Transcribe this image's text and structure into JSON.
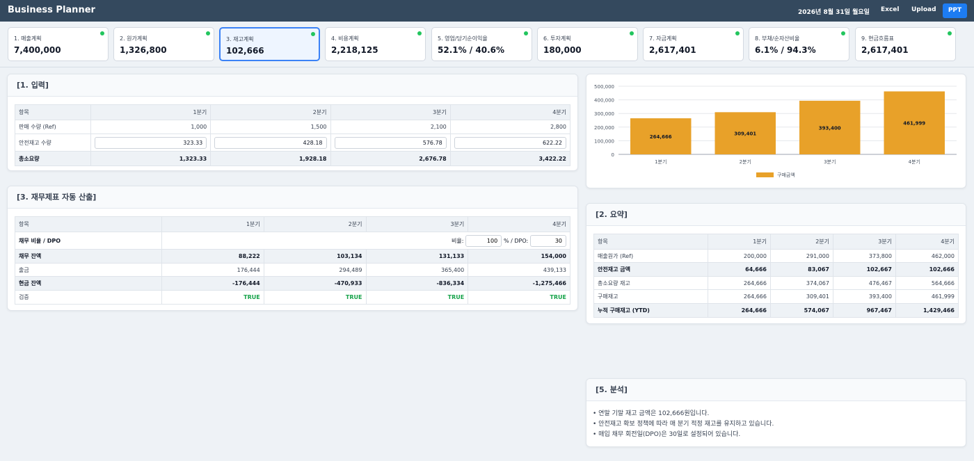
{
  "app": {
    "title": "Business Planner",
    "date": "2026년 8월 31일 월요일"
  },
  "header_buttons": {
    "excel": "Excel",
    "upload": "Upload",
    "ppt": "PPT"
  },
  "colors": {
    "header_bg": "#34495e",
    "accent": "#1d7cf2",
    "bar": "#e8a129",
    "status_dot": "#22c55e",
    "ok_text": "#16a34a"
  },
  "tabs": [
    {
      "label": "1. 매출계획",
      "value": "7,400,000",
      "active": false
    },
    {
      "label": "2. 원가계획",
      "value": "1,326,800",
      "active": false
    },
    {
      "label": "3. 재고계획",
      "value": "102,666",
      "active": true
    },
    {
      "label": "4. 비용계획",
      "value": "2,218,125",
      "active": false
    },
    {
      "label": "5. 영업/당기순이익율",
      "value": "52.1% / 40.6%",
      "active": false
    },
    {
      "label": "6. 투자계획",
      "value": "180,000",
      "active": false
    },
    {
      "label": "7. 자금계획",
      "value": "2,617,401",
      "active": false
    },
    {
      "label": "8. 부채/순자산비율",
      "value": "6.1% / 94.3%",
      "active": false
    },
    {
      "label": "9. 현금흐름표",
      "value": "2,617,401",
      "active": false
    }
  ],
  "input_section": {
    "title": "[1. 입력]",
    "headers": [
      "항목",
      "1분기",
      "2분기",
      "3분기",
      "4분기"
    ],
    "rows": [
      {
        "label": "판매 수량 (Ref)",
        "values": [
          "1,000",
          "1,500",
          "2,100",
          "2,800"
        ]
      },
      {
        "label": "안전재고 수량",
        "values": [
          "323.33",
          "428.18",
          "576.78",
          "622.22"
        ]
      },
      {
        "label": "총소요량",
        "values": [
          "1,323.33",
          "1,928.18",
          "2,676.78",
          "3,422.22"
        ]
      }
    ]
  },
  "finance_section": {
    "title": "[3. 재무제표 자동 산출]",
    "headers": [
      "항목",
      "1분기",
      "2분기",
      "3분기",
      "4분기"
    ],
    "ratio_row": {
      "label": "채무 비율 / DPO",
      "ratio_label": "비율:",
      "ratio_value": "100",
      "dpo_label": "% / DPO:",
      "dpo_value": "30"
    },
    "rows": [
      {
        "label": "채무 잔액",
        "values": [
          "88,222",
          "103,134",
          "131,133",
          "154,000"
        ]
      },
      {
        "label": "출금",
        "values": [
          "176,444",
          "294,489",
          "365,400",
          "439,133"
        ]
      },
      {
        "label": "현금 잔액",
        "values": [
          "-176,444",
          "-470,933",
          "-836,334",
          "-1,275,466"
        ]
      },
      {
        "label": "검증",
        "values": [
          "TRUE",
          "TRUE",
          "TRUE",
          "TRUE"
        ]
      }
    ]
  },
  "chart_data": {
    "type": "bar",
    "categories": [
      "1분기",
      "2분기",
      "3분기",
      "4분기"
    ],
    "series": [
      {
        "name": "구매금액",
        "values": [
          264666,
          309401,
          393400,
          461999
        ]
      }
    ],
    "data_labels": [
      "264,666",
      "309,401",
      "393,400",
      "461,999"
    ],
    "yticks": [
      "0",
      "100,000",
      "200,000",
      "300,000",
      "400,000",
      "500,000"
    ],
    "ylim": [
      0,
      500000
    ],
    "grid": true,
    "legend": "bottom-center",
    "title": "",
    "xlabel": "",
    "ylabel": ""
  },
  "summary_section": {
    "title": "[2. 요약]",
    "headers": [
      "항목",
      "1분기",
      "2분기",
      "3분기",
      "4분기"
    ],
    "rows": [
      {
        "label": "매출원가 (Ref)",
        "values": [
          "200,000",
          "291,000",
          "373,800",
          "462,000"
        ]
      },
      {
        "label": "안전재고 금액",
        "values": [
          "64,666",
          "83,067",
          "102,667",
          "102,666"
        ]
      },
      {
        "label": "총소요량 재고",
        "values": [
          "264,666",
          "374,067",
          "476,467",
          "564,666"
        ]
      },
      {
        "label": "구매재고",
        "values": [
          "264,666",
          "309,401",
          "393,400",
          "461,999"
        ]
      },
      {
        "label": "누적 구매재고 (YTD)",
        "values": [
          "264,666",
          "574,067",
          "967,467",
          "1,429,466"
        ]
      }
    ]
  },
  "analysis_section": {
    "title": "[5. 분석]",
    "lines": [
      "• 연말 기말 재고 금액은 102,666원입니다.",
      "• 안전재고 확보 정책에 따라 매 분기 적정 재고를 유지하고 있습니다.",
      "• 매입 채무 회전일(DPO)은 30일로 설정되어 있습니다."
    ]
  }
}
